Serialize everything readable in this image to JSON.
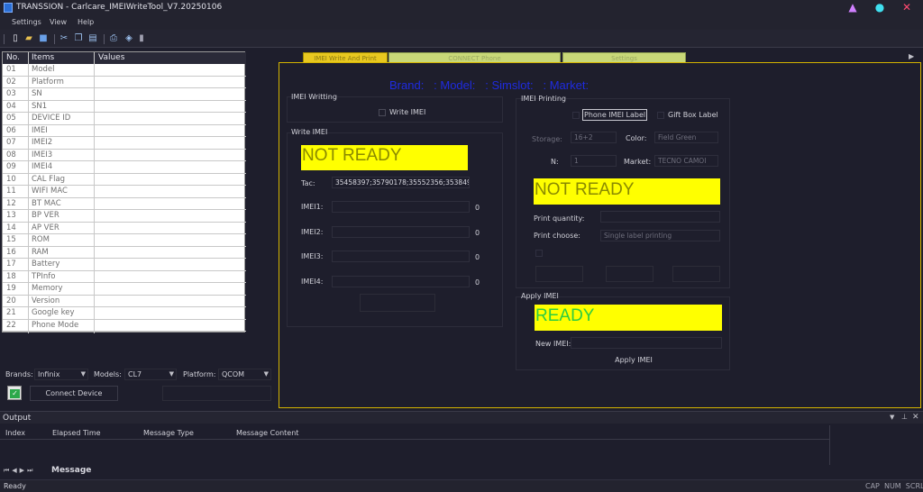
{
  "window": {
    "title": "TRANSSION - Carlcare_IMEIWriteTool_V7.20250106"
  },
  "menu": {
    "settings": "Settings",
    "view": "View",
    "help": "Help"
  },
  "table": {
    "headers": {
      "no": "No.",
      "items": "Items",
      "values": "Values"
    },
    "rows": [
      {
        "no": "01",
        "item": "Model"
      },
      {
        "no": "02",
        "item": "Platform"
      },
      {
        "no": "03",
        "item": "SN"
      },
      {
        "no": "04",
        "item": "SN1"
      },
      {
        "no": "05",
        "item": "DEVICE ID"
      },
      {
        "no": "06",
        "item": "IMEI"
      },
      {
        "no": "07",
        "item": "IMEI2"
      },
      {
        "no": "08",
        "item": "IMEI3"
      },
      {
        "no": "09",
        "item": "IMEI4"
      },
      {
        "no": "10",
        "item": "CAL Flag"
      },
      {
        "no": "11",
        "item": "WIFI MAC"
      },
      {
        "no": "12",
        "item": "BT MAC"
      },
      {
        "no": "13",
        "item": "BP VER"
      },
      {
        "no": "14",
        "item": "AP VER"
      },
      {
        "no": "15",
        "item": "ROM"
      },
      {
        "no": "16",
        "item": "RAM"
      },
      {
        "no": "17",
        "item": "Battery"
      },
      {
        "no": "18",
        "item": "TPInfo"
      },
      {
        "no": "19",
        "item": "Memory"
      },
      {
        "no": "20",
        "item": "Version"
      },
      {
        "no": "21",
        "item": "Google key"
      },
      {
        "no": "22",
        "item": "Phone Mode"
      }
    ]
  },
  "left_controls": {
    "brands_label": "Brands:",
    "brands_value": "Infinix",
    "models_label": "Models:",
    "models_value": "CL7",
    "platform_label": "Platform:",
    "platform_value": "QCOM",
    "connect_label": "Connect Device"
  },
  "tabs": [
    "IMEI Write And Print",
    "CONNECT Phone",
    "Settings"
  ],
  "header_line": "Brand:   : Model:   : Simslot:   : Market:",
  "imei_writing": {
    "title": "IMEI Writting",
    "write_imei": "Write IMEI"
  },
  "write_imei": {
    "title": "Write IMEI",
    "status": "NOT READY",
    "tac_label": "Tac:",
    "tac_value": "35458397;35790178;35552356;3538495",
    "imei1_label": "IMEI1:",
    "imei1_count": "0",
    "imei2_label": "IMEI2:",
    "imei2_count": "0",
    "imei3_label": "IMEI3:",
    "imei3_count": "0",
    "imei4_label": "IMEI4:",
    "imei4_count": "0"
  },
  "imei_printing": {
    "title": "IMEI Printing",
    "phone_label": "Phone IMEI Label",
    "gift_label": "Gift Box Label",
    "storage_label": "Storage:",
    "storage_value": "16+2",
    "color_label": "Color:",
    "color_value": "Field Green",
    "n_label": "N:",
    "n_value": "1",
    "market_label": "Market:",
    "market_value": "TECNO CAMOI",
    "status": "NOT READY",
    "print_qty_label": "Print quantity:",
    "print_choose_label": "Print choose:",
    "print_choose_value": "Single label printing"
  },
  "apply_imei": {
    "title": "Apply IMEI",
    "status": "READY",
    "new_imei_label": "New IMEI:",
    "apply_button": "Apply IMEI"
  },
  "output": {
    "title": "Output",
    "columns": [
      "Index",
      "Elapsed Time",
      "Message Type",
      "Message Content"
    ],
    "message_tab": "Message"
  },
  "status": {
    "left": "Ready",
    "indicators": "CAP  NUM  SCRL"
  },
  "colors": {
    "accent_yellow": "#ffff00",
    "ready_green": "#2ecc40",
    "header_blue": "#1f2be0",
    "frame_gold": "#d4b400"
  }
}
